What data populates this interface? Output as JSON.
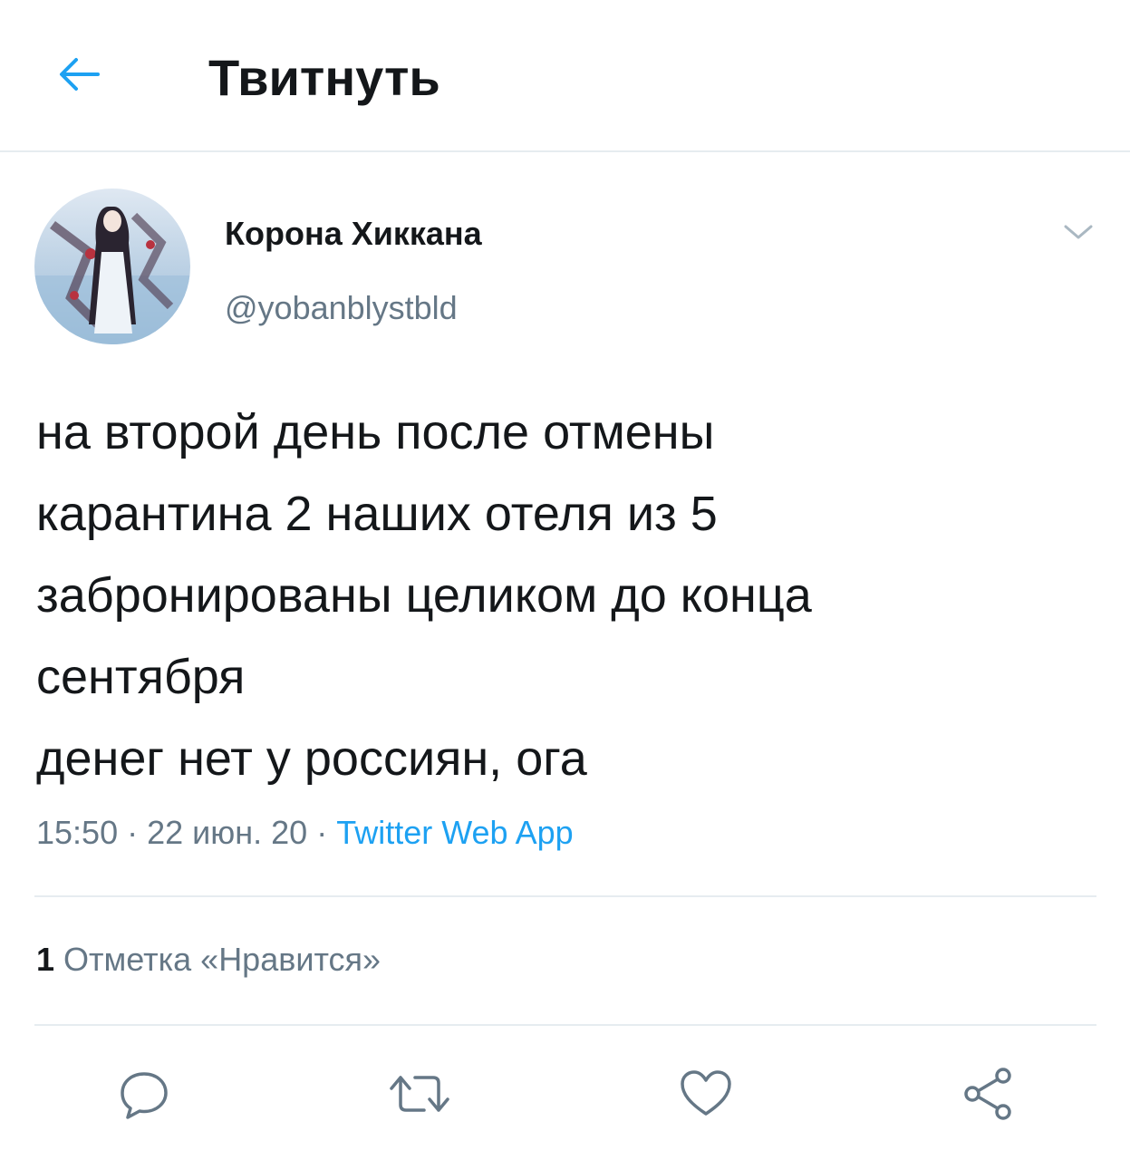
{
  "header": {
    "title": "Твитнуть",
    "back_icon": "arrow-left-icon"
  },
  "colors": {
    "accent": "#1da1f2",
    "text": "#14171a",
    "secondary": "#657786",
    "divider": "#e6ecf0"
  },
  "tweet": {
    "author_name": "Корона Хиккана",
    "author_handle": "@yobanblystbld",
    "lines": [
      "на второй день после отмены",
      "карантина 2 наших отеля из 5",
      "забронированы целиком до конца",
      "сентября",
      "денег нет у россиян, ога"
    ],
    "time": "15:50",
    "date": "22 июн. 20",
    "separator": " · ",
    "source": "Twitter Web App"
  },
  "stats": {
    "likes_count": "1",
    "likes_label": "Отметка «Нравится»"
  },
  "actions": [
    {
      "name": "reply-icon"
    },
    {
      "name": "retweet-icon"
    },
    {
      "name": "like-icon"
    },
    {
      "name": "share-icon"
    }
  ]
}
